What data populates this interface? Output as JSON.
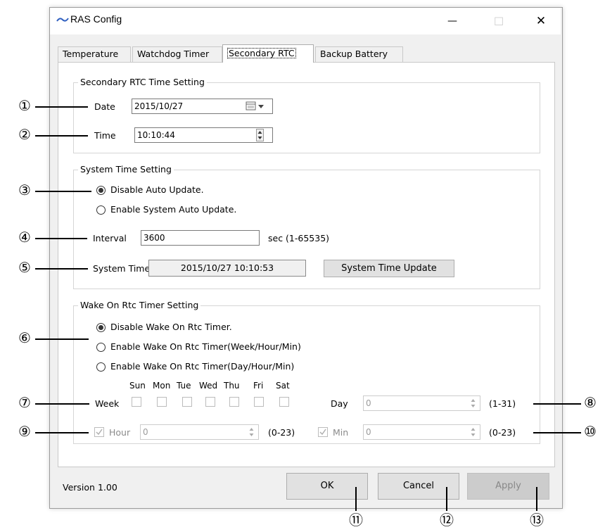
{
  "window": {
    "title": "RAS Config",
    "minimize_glyph": "—",
    "maximize_glyph": "☐",
    "close_glyph": "✕"
  },
  "tabs": [
    {
      "label": "Temperature",
      "active": false
    },
    {
      "label": "Watchdog Timer",
      "active": false
    },
    {
      "label": "Secondary RTC",
      "active": true
    },
    {
      "label": "Backup Battery",
      "active": false
    }
  ],
  "rtc_group": {
    "legend": "Secondary RTC Time Setting",
    "date_label": "Date",
    "date_value": "2015/10/27",
    "time_label": "Time",
    "time_value": "10:10:44"
  },
  "system_group": {
    "legend": "System Time Setting",
    "option_disable": "Disable Auto Update.",
    "option_enable": "Enable System Auto Update.",
    "selected": "disable",
    "interval_label": "Interval",
    "interval_value": "3600",
    "interval_unit": "sec (1-65535)",
    "system_time_label": "System Time",
    "system_time_value": "2015/10/27 10:10:53",
    "update_button": "System Time Update"
  },
  "wake_group": {
    "legend": "Wake On Rtc Timer Setting",
    "option_disable": "Disable Wake On Rtc Timer.",
    "option_week": "Enable Wake On Rtc Timer(Week/Hour/Min)",
    "option_day": "Enable Wake On Rtc Timer(Day/Hour/Min)",
    "selected": "disable",
    "week_label": "Week",
    "days": [
      "Sun",
      "Mon",
      "Tue",
      "Wed",
      "Thu",
      "Fri",
      "Sat"
    ],
    "day_label": "Day",
    "day_value": "0",
    "day_range": "(1-31)",
    "hour_label": "Hour",
    "hour_value": "0",
    "hour_range": "(0-23)",
    "min_label": "Min",
    "min_value": "0",
    "min_range": "(0-23)"
  },
  "footer": {
    "version": "Version 1.00",
    "ok": "OK",
    "cancel": "Cancel",
    "apply": "Apply"
  },
  "callouts": {
    "c1": "①",
    "c2": "②",
    "c3": "③",
    "c4": "④",
    "c5": "⑤",
    "c6": "⑥",
    "c7": "⑦",
    "c8": "⑧",
    "c9": "⑨",
    "c10": "⑩",
    "c11": "⑪",
    "c12": "⑫",
    "c13": "⑬"
  }
}
